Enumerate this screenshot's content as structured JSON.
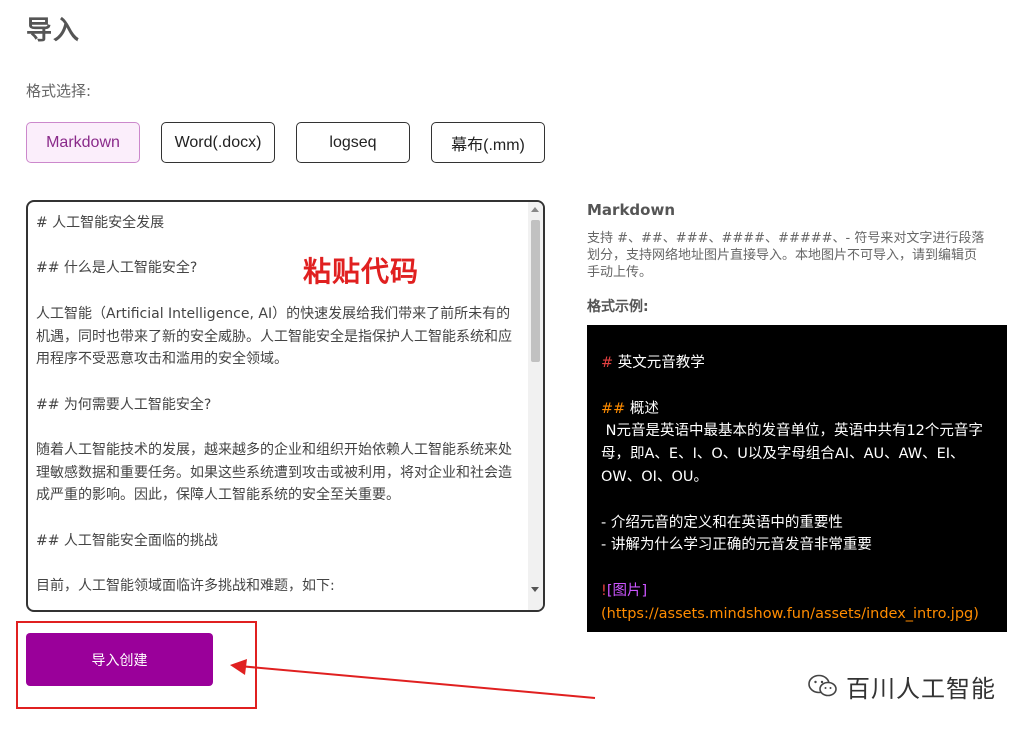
{
  "page": {
    "title": "导入"
  },
  "format": {
    "label": "格式选择:",
    "options": [
      "Markdown",
      "Word(.docx)",
      "logseq",
      "幕布(.mm)"
    ],
    "selected": "Markdown"
  },
  "editor": {
    "content": "# 人工智能安全发展\n\n## 什么是人工智能安全?\n\n人工智能（Artificial Intelligence, AI）的快速发展给我们带来了前所未有的机遇，同时也带来了新的安全威胁。人工智能安全是指保护人工智能系统和应用程序不受恶意攻击和滥用的安全领域。\n\n## 为何需要人工智能安全?\n\n随着人工智能技术的发展，越来越多的企业和组织开始依赖人工智能系统来处理敏感数据和重要任务。如果这些系统遭到攻击或被利用，将对企业和社会造成严重的影响。因此，保障人工智能系统的安全至关重要。\n\n## 人工智能安全面临的挑战\n\n目前，人工智能领域面临许多挑战和难题，如下:"
  },
  "annotation": {
    "paste_code": "粘贴代码"
  },
  "actions": {
    "import_create": "导入创建"
  },
  "info": {
    "title": "Markdown",
    "description": "支持 #、##、###、####、#####、- 符号来对文字进行段落划分，支持网络地址图片直接导入。本地图片不可导入，请到编辑页手动上传。",
    "example_label": "格式示例:"
  },
  "example": {
    "h1_mark": "#",
    "h1_text": " 英文元音教学",
    "h2_mark": "##",
    "h2_text": " 概述",
    "para": " N元音是英语中最基本的发音单位，英语中共有12个元音字母，即A、E、I、O、U以及字母组合AI、AU、AW、EI、OW、OI、OU。",
    "bullet1": "- 介绍元音的定义和在英语中的重要性",
    "bullet2": "- 讲解为什么学习正确的元音发音非常重要",
    "img_excl": "!",
    "img_alt": "[图片]",
    "img_url": "(https://assets.mindshow.fun/assets/index_intro.jpg)"
  },
  "watermark": {
    "text": "百川人工智能",
    "icon": "wechat-icon"
  },
  "colors": {
    "accent": "#9a009a",
    "annotation": "#e02020",
    "selected_tab_bg": "#fbeefb",
    "example_bg": "#000000"
  }
}
